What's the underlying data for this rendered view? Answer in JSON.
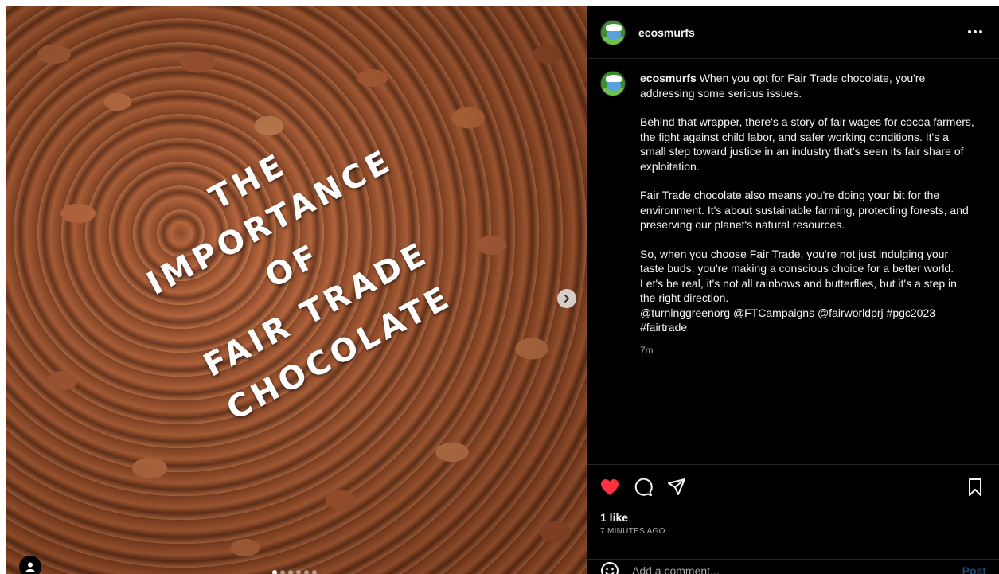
{
  "post": {
    "media": {
      "title_lines": [
        "THE",
        "IMPORTANCE",
        "OF",
        "FAIR TRADE",
        "CHOCOLATE"
      ],
      "carousel_count": 6,
      "carousel_active": 1
    },
    "header": {
      "username": "ecosmurfs"
    },
    "caption": {
      "username": "ecosmurfs",
      "paragraphs": [
        "When you opt for Fair Trade chocolate, you're addressing some serious issues.",
        "Behind that wrapper, there's a story of fair wages for cocoa farmers, the fight against child labor, and safer working conditions. It's a small step toward justice in an industry that's seen its fair share of exploitation.",
        "Fair Trade chocolate also means you're doing your bit for the environment. It's about sustainable farming, protecting forests, and preserving our planet's natural resources.",
        "So, when you choose Fair Trade, you're not just indulging your taste buds, you're making a conscious choice for a better world. Let's be real, it's not all rainbows and butterflies, but it's a step in the right direction."
      ],
      "tags": "@turninggreenorg @FTCampaigns @fairworldprj #pgc2023 #fairtrade",
      "time": "7m"
    },
    "engagement": {
      "likes": "1 like",
      "posted_ago": "7 MINUTES AGO",
      "liked": true,
      "like_color": "#ff3040"
    },
    "comment": {
      "placeholder": "Add a comment...",
      "post_label": "Post"
    }
  }
}
